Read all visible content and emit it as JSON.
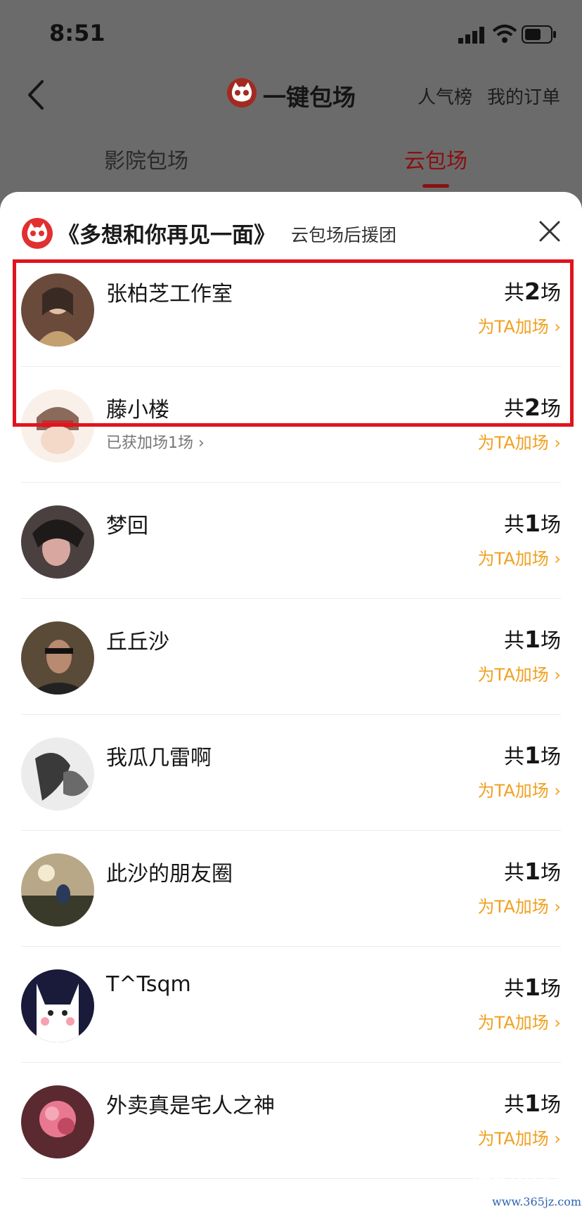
{
  "status_bar": {
    "time": "8:51"
  },
  "nav": {
    "title": "一键包场",
    "links": [
      "人气榜",
      "我的订单"
    ]
  },
  "tabs": [
    {
      "label": "影院包场",
      "active": false
    },
    {
      "label": "云包场",
      "active": true
    }
  ],
  "sheet": {
    "title": "《多想和你再见一面》",
    "subtitle": "云包场后援团"
  },
  "colors": {
    "accent": "#8a1010",
    "brand_red": "#e03030",
    "add_orange": "#f0a020",
    "highlight": "#e0141e"
  },
  "rows": [
    {
      "name": "张柏芝工作室",
      "count_prefix": "共",
      "count": "2",
      "count_suffix": "场",
      "add_label": "为TA加场 ›",
      "sub": ""
    },
    {
      "name": "藤小楼",
      "count_prefix": "共",
      "count": "2",
      "count_suffix": "场",
      "add_label": "为TA加场 ›",
      "sub": "已获加场1场 ›"
    },
    {
      "name": "梦回",
      "count_prefix": "共",
      "count": "1",
      "count_suffix": "场",
      "add_label": "为TA加场 ›",
      "sub": ""
    },
    {
      "name": "丘丘沙",
      "count_prefix": "共",
      "count": "1",
      "count_suffix": "场",
      "add_label": "为TA加场 ›",
      "sub": ""
    },
    {
      "name": "我瓜几雷啊",
      "count_prefix": "共",
      "count": "1",
      "count_suffix": "场",
      "add_label": "为TA加场 ›",
      "sub": ""
    },
    {
      "name": "此沙的朋友圈",
      "count_prefix": "共",
      "count": "1",
      "count_suffix": "场",
      "add_label": "为TA加场 ›",
      "sub": ""
    },
    {
      "name": "T^Tsqm",
      "count_prefix": "共",
      "count": "1",
      "count_suffix": "场",
      "add_label": "为TA加场 ›",
      "sub": ""
    },
    {
      "name": "外卖真是宅人之神",
      "count_prefix": "共",
      "count": "1",
      "count_suffix": "场",
      "add_label": "为TA加场 ›",
      "sub": ""
    }
  ],
  "watermark": {
    "text": "娱说电影",
    "url": "www.365jz.com"
  }
}
